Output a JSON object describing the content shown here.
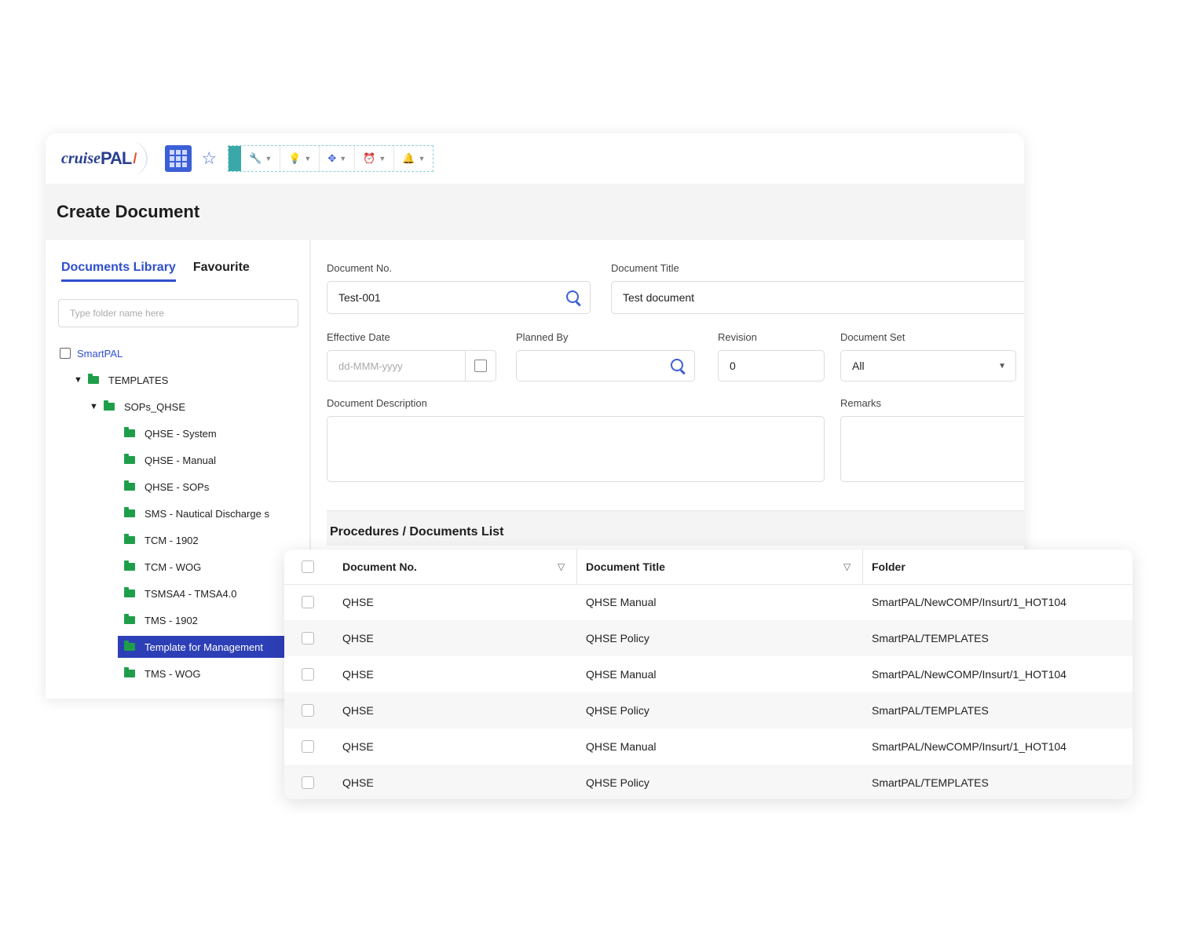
{
  "app": {
    "logo_text_1": "cruise",
    "logo_text_2": "PAL",
    "logo_mark": "/"
  },
  "toolbar": {
    "tools": [
      {
        "icon": "wrench-icon",
        "glyph": "🔧"
      },
      {
        "icon": "lightbulb-icon",
        "glyph": "💡"
      },
      {
        "icon": "compass-icon",
        "glyph": "✥"
      },
      {
        "icon": "alarm-icon",
        "glyph": "⏰"
      },
      {
        "icon": "bell-icon",
        "glyph": "🔔"
      }
    ]
  },
  "page": {
    "title": "Create Document"
  },
  "sidebar": {
    "tabs": [
      "Documents Library",
      "Favourite"
    ],
    "search_placeholder": "Type folder name here",
    "tree": {
      "root": "SmartPAL",
      "templates": "TEMPLATES",
      "sops": "SOPs_QHSE",
      "children": [
        "QHSE - System",
        "QHSE - Manual",
        "QHSE - SOPs",
        "SMS - Nautical Discharge s",
        "TCM - 1902",
        "TCM - WOG",
        "TSMSA4 - TMSA4.0",
        "TMS - 1902",
        "Template for Management",
        "TMS - WOG"
      ],
      "selected": "Template for Management"
    }
  },
  "form": {
    "doc_no_label": "Document No.",
    "doc_no_value": "Test-001",
    "doc_title_label": "Document Title",
    "doc_title_value": "Test document",
    "eff_date_label": "Effective Date",
    "eff_date_placeholder": "dd-MMM-yyyy",
    "planned_by_label": "Planned By",
    "revision_label": "Revision",
    "revision_value": "0",
    "doc_set_label": "Document Set",
    "doc_set_value": "All",
    "description_label": "Document Description",
    "remarks_label": "Remarks"
  },
  "procedures": {
    "title": "Procedures / Documents List",
    "columns": [
      "Document No.",
      "Document Title",
      "Folder"
    ],
    "rows": [
      {
        "no": "QHSE",
        "title": "QHSE Manual",
        "folder": "SmartPAL/NewCOMP/Insurt/1_HOT104"
      },
      {
        "no": "QHSE",
        "title": "QHSE Policy",
        "folder": "SmartPAL/TEMPLATES"
      },
      {
        "no": "QHSE",
        "title": "QHSE Manual",
        "folder": "SmartPAL/NewCOMP/Insurt/1_HOT104"
      },
      {
        "no": "QHSE",
        "title": "QHSE Policy",
        "folder": "SmartPAL/TEMPLATES"
      },
      {
        "no": "QHSE",
        "title": "QHSE Manual",
        "folder": "SmartPAL/NewCOMP/Insurt/1_HOT104"
      },
      {
        "no": "QHSE",
        "title": "QHSE Policy",
        "folder": "SmartPAL/TEMPLATES"
      }
    ]
  },
  "colors": {
    "accent": "#2f4fcf",
    "folder": "#1f9e4a",
    "selected_bg": "#2d3fb6"
  }
}
